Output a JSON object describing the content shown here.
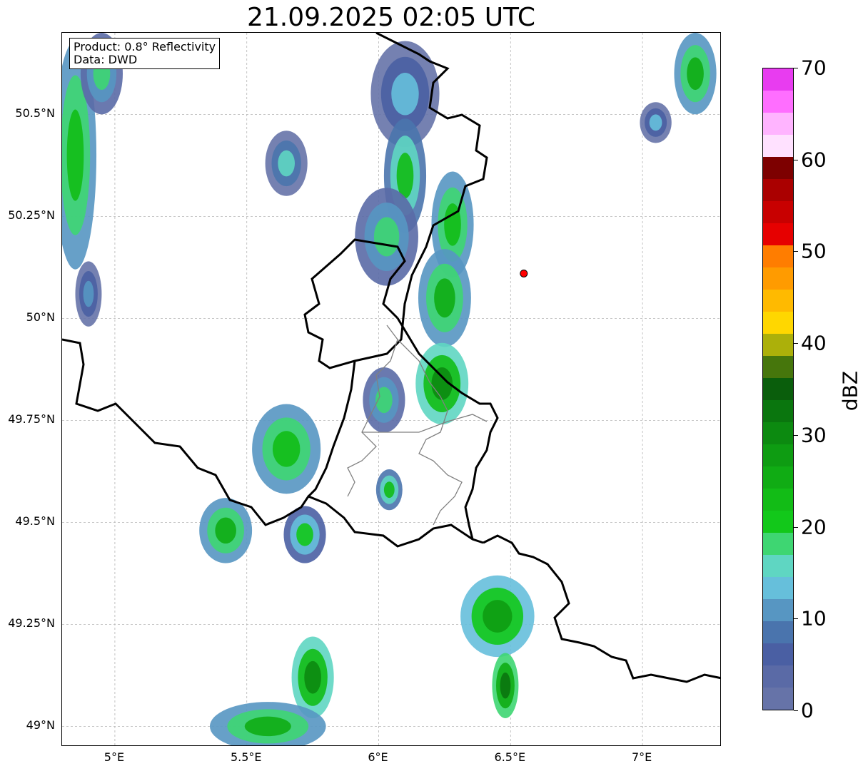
{
  "title": "21.09.2025 02:05 UTC",
  "info": {
    "product": "Product: 0.8° Reflectivity",
    "data_source": "Data: DWD"
  },
  "lat_ticks": [
    {
      "value": 50.5,
      "label": "50.5°N"
    },
    {
      "value": 50.25,
      "label": "50.25°N"
    },
    {
      "value": 50.0,
      "label": "50°N"
    },
    {
      "value": 49.75,
      "label": "49.75°N"
    },
    {
      "value": 49.5,
      "label": "49.5°N"
    },
    {
      "value": 49.25,
      "label": "49.25°N"
    },
    {
      "value": 49.0,
      "label": "49°N"
    }
  ],
  "lon_ticks": [
    {
      "value": 5.0,
      "label": "5°E"
    },
    {
      "value": 5.5,
      "label": "5.5°E"
    },
    {
      "value": 6.0,
      "label": "6°E"
    },
    {
      "value": 6.5,
      "label": "6.5°E"
    },
    {
      "value": 7.0,
      "label": "7°E"
    }
  ],
  "map_extent": {
    "lon_min": 4.8,
    "lon_max": 7.3,
    "lat_min": 48.95,
    "lat_max": 50.7
  },
  "radar_site": {
    "lon": 6.55,
    "lat": 50.11,
    "color": "#ff0000"
  },
  "colorbar": {
    "unit": "dBZ",
    "min": 0,
    "max": 70,
    "tick_values": [
      0,
      10,
      20,
      30,
      40,
      50,
      60,
      70
    ],
    "tick_labels": [
      "0",
      "10",
      "20",
      "30",
      "40",
      "50",
      "60",
      "70"
    ],
    "colors": [
      "#6673a8",
      "#5a6aa6",
      "#4a5fa3",
      "#4a74ad",
      "#5796c2",
      "#66bfdb",
      "#5fd6c2",
      "#3ed672",
      "#12c81a",
      "#12bc16",
      "#10ac14",
      "#0e9c12",
      "#0c8a10",
      "#0a760e",
      "#0a5e0c",
      "#46760c",
      "#acb00a",
      "#ffd700",
      "#ffba00",
      "#ff9b00",
      "#ff7d00",
      "#e60000",
      "#c80000",
      "#aa0000",
      "#7d0000",
      "#ffe1ff",
      "#ffb4ff",
      "#ff6eff",
      "#e83cf0"
    ]
  },
  "echoes": [
    {
      "lon": 4.85,
      "lat": 50.4,
      "rx": 0.08,
      "ry": 0.28,
      "intensity": 24
    },
    {
      "lon": 4.95,
      "lat": 50.6,
      "rx": 0.08,
      "ry": 0.1,
      "intensity": 18
    },
    {
      "lon": 4.9,
      "lat": 50.06,
      "rx": 0.05,
      "ry": 0.08,
      "intensity": 12
    },
    {
      "lon": 5.65,
      "lat": 50.38,
      "rx": 0.08,
      "ry": 0.08,
      "intensity": 16
    },
    {
      "lon": 6.1,
      "lat": 50.55,
      "rx": 0.13,
      "ry": 0.13,
      "intensity": 14
    },
    {
      "lon": 6.1,
      "lat": 50.35,
      "rx": 0.08,
      "ry": 0.14,
      "intensity": 22
    },
    {
      "lon": 6.03,
      "lat": 50.2,
      "rx": 0.12,
      "ry": 0.12,
      "intensity": 18
    },
    {
      "lon": 6.28,
      "lat": 50.23,
      "rx": 0.08,
      "ry": 0.13,
      "intensity": 24
    },
    {
      "lon": 6.25,
      "lat": 50.05,
      "rx": 0.1,
      "ry": 0.12,
      "intensity": 26
    },
    {
      "lon": 6.24,
      "lat": 49.84,
      "rx": 0.1,
      "ry": 0.1,
      "intensity": 30
    },
    {
      "lon": 6.02,
      "lat": 49.8,
      "rx": 0.08,
      "ry": 0.08,
      "intensity": 18
    },
    {
      "lon": 5.65,
      "lat": 49.68,
      "rx": 0.13,
      "ry": 0.11,
      "intensity": 24
    },
    {
      "lon": 5.42,
      "lat": 49.48,
      "rx": 0.1,
      "ry": 0.08,
      "intensity": 26
    },
    {
      "lon": 5.72,
      "lat": 49.47,
      "rx": 0.08,
      "ry": 0.07,
      "intensity": 20
    },
    {
      "lon": 6.45,
      "lat": 49.27,
      "rx": 0.14,
      "ry": 0.1,
      "intensity": 28
    },
    {
      "lon": 6.48,
      "lat": 49.1,
      "rx": 0.05,
      "ry": 0.08,
      "intensity": 32
    },
    {
      "lon": 5.75,
      "lat": 49.12,
      "rx": 0.08,
      "ry": 0.1,
      "intensity": 30
    },
    {
      "lon": 5.58,
      "lat": 49.0,
      "rx": 0.22,
      "ry": 0.06,
      "intensity": 26
    },
    {
      "lon": 7.2,
      "lat": 50.6,
      "rx": 0.08,
      "ry": 0.1,
      "intensity": 26
    },
    {
      "lon": 7.05,
      "lat": 50.48,
      "rx": 0.06,
      "ry": 0.05,
      "intensity": 14
    },
    {
      "lon": 6.04,
      "lat": 49.58,
      "rx": 0.05,
      "ry": 0.05,
      "intensity": 22
    }
  ]
}
